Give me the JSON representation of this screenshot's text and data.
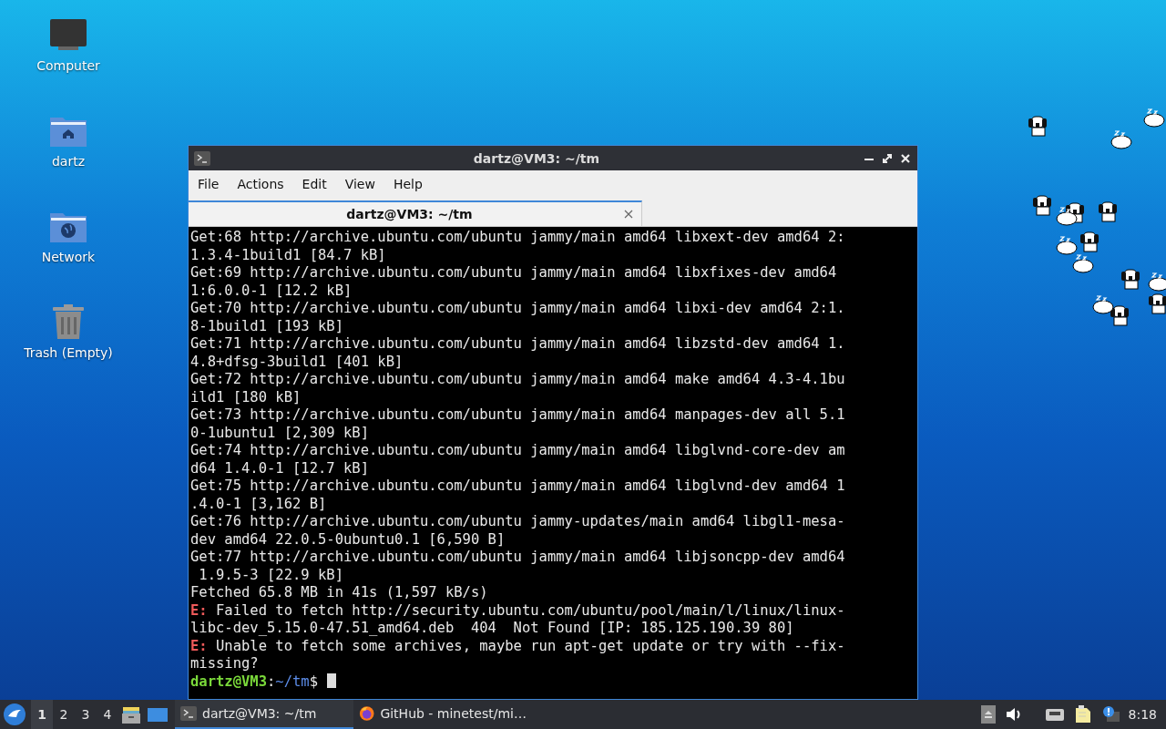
{
  "desktop_icons": [
    {
      "kind": "computer",
      "label": "Computer"
    },
    {
      "kind": "home",
      "label": "dartz"
    },
    {
      "kind": "network",
      "label": "Network"
    },
    {
      "kind": "trash",
      "label": "Trash (Empty)"
    }
  ],
  "window": {
    "title": "dartz@VM3: ~/tm",
    "menu": [
      "File",
      "Actions",
      "Edit",
      "View",
      "Help"
    ],
    "tabs": [
      {
        "label": "dartz@VM3: ~/tm",
        "selected": true
      }
    ],
    "terminal_lines": [
      {
        "kind": "output",
        "text": "Get:68 http://archive.ubuntu.com/ubuntu jammy/main amd64 libxext-dev amd64 2:"
      },
      {
        "kind": "output",
        "text": "1.3.4-1build1 [84.7 kB]"
      },
      {
        "kind": "output",
        "text": "Get:69 http://archive.ubuntu.com/ubuntu jammy/main amd64 libxfixes-dev amd64"
      },
      {
        "kind": "output",
        "text": "1:6.0.0-1 [12.2 kB]"
      },
      {
        "kind": "output",
        "text": "Get:70 http://archive.ubuntu.com/ubuntu jammy/main amd64 libxi-dev amd64 2:1."
      },
      {
        "kind": "output",
        "text": "8-1build1 [193 kB]"
      },
      {
        "kind": "output",
        "text": "Get:71 http://archive.ubuntu.com/ubuntu jammy/main amd64 libzstd-dev amd64 1."
      },
      {
        "kind": "output",
        "text": "4.8+dfsg-3build1 [401 kB]"
      },
      {
        "kind": "output",
        "text": "Get:72 http://archive.ubuntu.com/ubuntu jammy/main amd64 make amd64 4.3-4.1bu"
      },
      {
        "kind": "output",
        "text": "ild1 [180 kB]"
      },
      {
        "kind": "output",
        "text": "Get:73 http://archive.ubuntu.com/ubuntu jammy/main amd64 manpages-dev all 5.1"
      },
      {
        "kind": "output",
        "text": "0-1ubuntu1 [2,309 kB]"
      },
      {
        "kind": "output",
        "text": "Get:74 http://archive.ubuntu.com/ubuntu jammy/main amd64 libglvnd-core-dev am"
      },
      {
        "kind": "output",
        "text": "d64 1.4.0-1 [12.7 kB]"
      },
      {
        "kind": "output",
        "text": "Get:75 http://archive.ubuntu.com/ubuntu jammy/main amd64 libglvnd-dev amd64 1"
      },
      {
        "kind": "output",
        "text": ".4.0-1 [3,162 B]"
      },
      {
        "kind": "output",
        "text": "Get:76 http://archive.ubuntu.com/ubuntu jammy-updates/main amd64 libgl1-mesa-"
      },
      {
        "kind": "output",
        "text": "dev amd64 22.0.5-0ubuntu0.1 [6,590 B]"
      },
      {
        "kind": "output",
        "text": "Get:77 http://archive.ubuntu.com/ubuntu jammy/main amd64 libjsoncpp-dev amd64"
      },
      {
        "kind": "output",
        "text": " 1.9.5-3 [22.9 kB]"
      },
      {
        "kind": "output",
        "text": "Fetched 65.8 MB in 41s (1,597 kB/s)"
      },
      {
        "kind": "error",
        "prefix": "E:",
        "text": " Failed to fetch http://security.ubuntu.com/ubuntu/pool/main/l/linux/linux-"
      },
      {
        "kind": "output",
        "text": "libc-dev_5.15.0-47.51_amd64.deb  404  Not Found [IP: 185.125.190.39 80]"
      },
      {
        "kind": "error",
        "prefix": "E:",
        "text": " Unable to fetch some archives, maybe run apt-get update or try with --fix-"
      },
      {
        "kind": "output",
        "text": "missing?"
      },
      {
        "kind": "prompt",
        "user": "dartz@VM3",
        "sep": ":",
        "path": "~/tm",
        "symbol": "$"
      }
    ]
  },
  "taskbar": {
    "workspaces": [
      {
        "label": "1",
        "selected": true
      },
      {
        "label": "2",
        "selected": false
      },
      {
        "label": "3",
        "selected": false
      },
      {
        "label": "4",
        "selected": false
      }
    ],
    "tasks": [
      {
        "kind": "terminal",
        "label": "dartz@VM3: ~/tm",
        "selected": true
      },
      {
        "kind": "browser",
        "label": "GitHub - minetest/mi…",
        "selected": false
      }
    ],
    "clock": "8:18"
  }
}
